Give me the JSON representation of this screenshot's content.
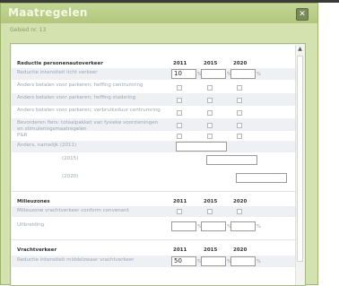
{
  "dialog": {
    "title": "Maatregelen",
    "close_symbol": "✕",
    "subtitle": "Gebied nr. 13"
  },
  "years": [
    "2011",
    "2015",
    "2020"
  ],
  "percent_sign": "%",
  "sections": {
    "reductie": {
      "title": "Reductie personenautoverkeer",
      "rows": {
        "intensiteit": {
          "label": "Reductie intensiteit licht verkeer",
          "value_2011": "10"
        },
        "parkeren_heffing_centrum": {
          "label": "Anders betalen voor parkeren; heffing centrumring"
        },
        "parkeren_heffing_stad": {
          "label": "Anders betalen voor parkeren; heffing stadsring"
        },
        "parkeren_verbruik": {
          "label": "Anders betalen voor parkeren; verbruiksduur centrumring"
        },
        "fiets": {
          "label": "Bevorderen fiets: totaalpakket van fysieke voorzieningen en stimuleringsmaatregelen"
        },
        "pr": {
          "label": "P&R"
        },
        "anders_2011": {
          "label": "Anders, namelijk (2011)"
        },
        "anders_2015": {
          "label": "(2015)"
        },
        "anders_2020": {
          "label": "(2020)"
        }
      }
    },
    "milieuzones": {
      "title": "Milieuzones",
      "rows": {
        "vracht": {
          "label": "Milieuzone vrachtverkeer conform convenant"
        },
        "uitbreiding": {
          "label": "Uitbreiding"
        }
      }
    },
    "vrachtverkeer": {
      "title": "Vrachtverkeer",
      "rows": {
        "reductie": {
          "label": "Reductie intensiteit middelzwaar vrachtverkeer",
          "value_2011": "50"
        }
      }
    }
  }
}
